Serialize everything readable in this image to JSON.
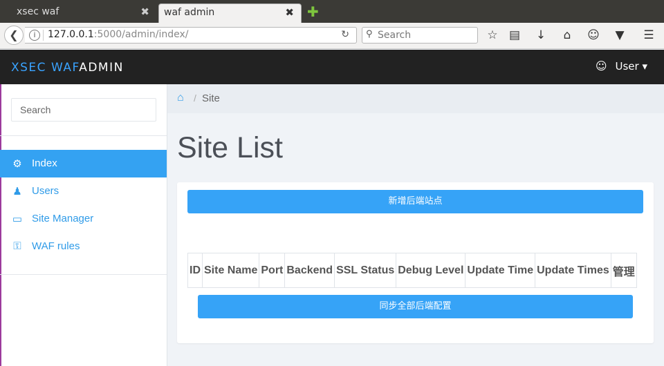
{
  "browser": {
    "tabs": [
      {
        "title": "xsec waf",
        "active": false
      },
      {
        "title": "waf admin",
        "active": true
      }
    ],
    "tab_close_glyph": "✖",
    "new_tab_glyph": "✚",
    "url": {
      "host": "127.0.0.1",
      "rest": ":5000/admin/index/"
    },
    "search_placeholder": "Search",
    "toolbar_icons": [
      "star-icon",
      "reading-list-icon",
      "download-icon",
      "home-icon",
      "emoji-icon",
      "pocket-icon",
      "menu-icon"
    ]
  },
  "app": {
    "brand_accent": "XSEC WAF",
    "brand_main": "ADMIN",
    "user_label": "User ▾",
    "accent_color": "#34a2f2"
  },
  "sidebar": {
    "search_placeholder": "Search",
    "items": [
      {
        "label": "Index",
        "icon": "gear-icon",
        "active": true
      },
      {
        "label": "Users",
        "icon": "user-icon",
        "active": false
      },
      {
        "label": "Site Manager",
        "icon": "monitor-icon",
        "active": false
      },
      {
        "label": "WAF rules",
        "icon": "lock-icon",
        "active": false
      }
    ]
  },
  "breadcrumb": {
    "current": "Site",
    "separator": "/"
  },
  "main": {
    "title": "Site List",
    "add_button": "新增后端站点",
    "sync_button": "同步全部后端配置",
    "table_headers": [
      "ID",
      "Site Name",
      "Port",
      "Backend",
      "SSL Status",
      "Debug Level",
      "Update Time",
      "Update Times",
      "管理"
    ]
  }
}
